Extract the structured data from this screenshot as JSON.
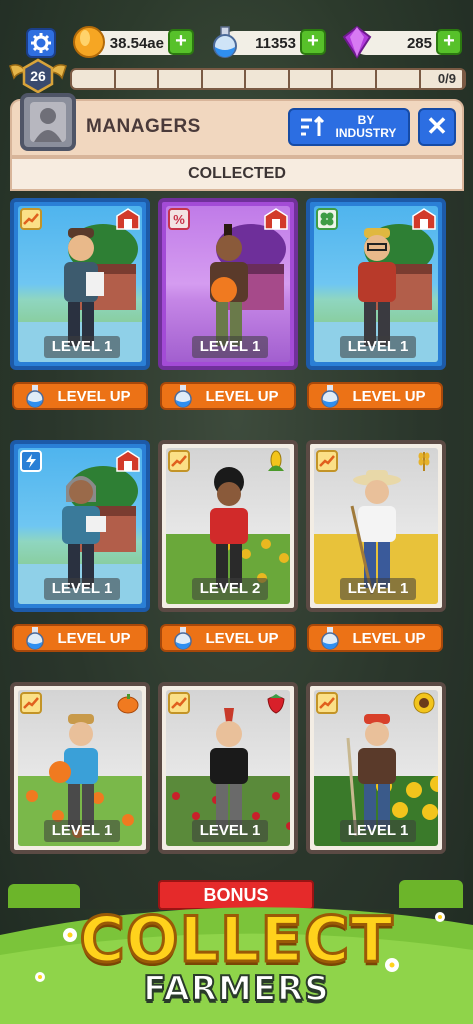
{
  "resources": {
    "coins": "38.54ae",
    "potions": "11353",
    "gems": "285",
    "plus": "+"
  },
  "player": {
    "level": "26",
    "progress_text": "0/9",
    "progress": 0
  },
  "panel": {
    "title": "MANAGERS",
    "sort_label": "BY INDUSTRY",
    "close_symbol": "✕",
    "section": "COLLECTED"
  },
  "cards": [
    {
      "level_label": "LEVEL 1",
      "button": "LEVEL UP"
    },
    {
      "level_label": "LEVEL 1",
      "button": "LEVEL UP"
    },
    {
      "level_label": "LEVEL 1",
      "button": "LEVEL UP"
    },
    {
      "level_label": "LEVEL 1",
      "button": "LEVEL UP"
    },
    {
      "level_label": "LEVEL 2",
      "button": "LEVEL UP"
    },
    {
      "level_label": "LEVEL 1",
      "button": "LEVEL UP"
    },
    {
      "level_label": "LEVEL 1"
    },
    {
      "level_label": "LEVEL 1"
    },
    {
      "level_label": "LEVEL 1"
    }
  ],
  "bonus_label": "BONUS",
  "promo": {
    "line1": "COLLECT",
    "line2": "FARMERS"
  },
  "colors": {
    "accent_blue": "#2c6ee2",
    "level_up_orange": "#ec7216",
    "bonus_red": "#e52a2a",
    "plus_green": "#57c12a"
  }
}
